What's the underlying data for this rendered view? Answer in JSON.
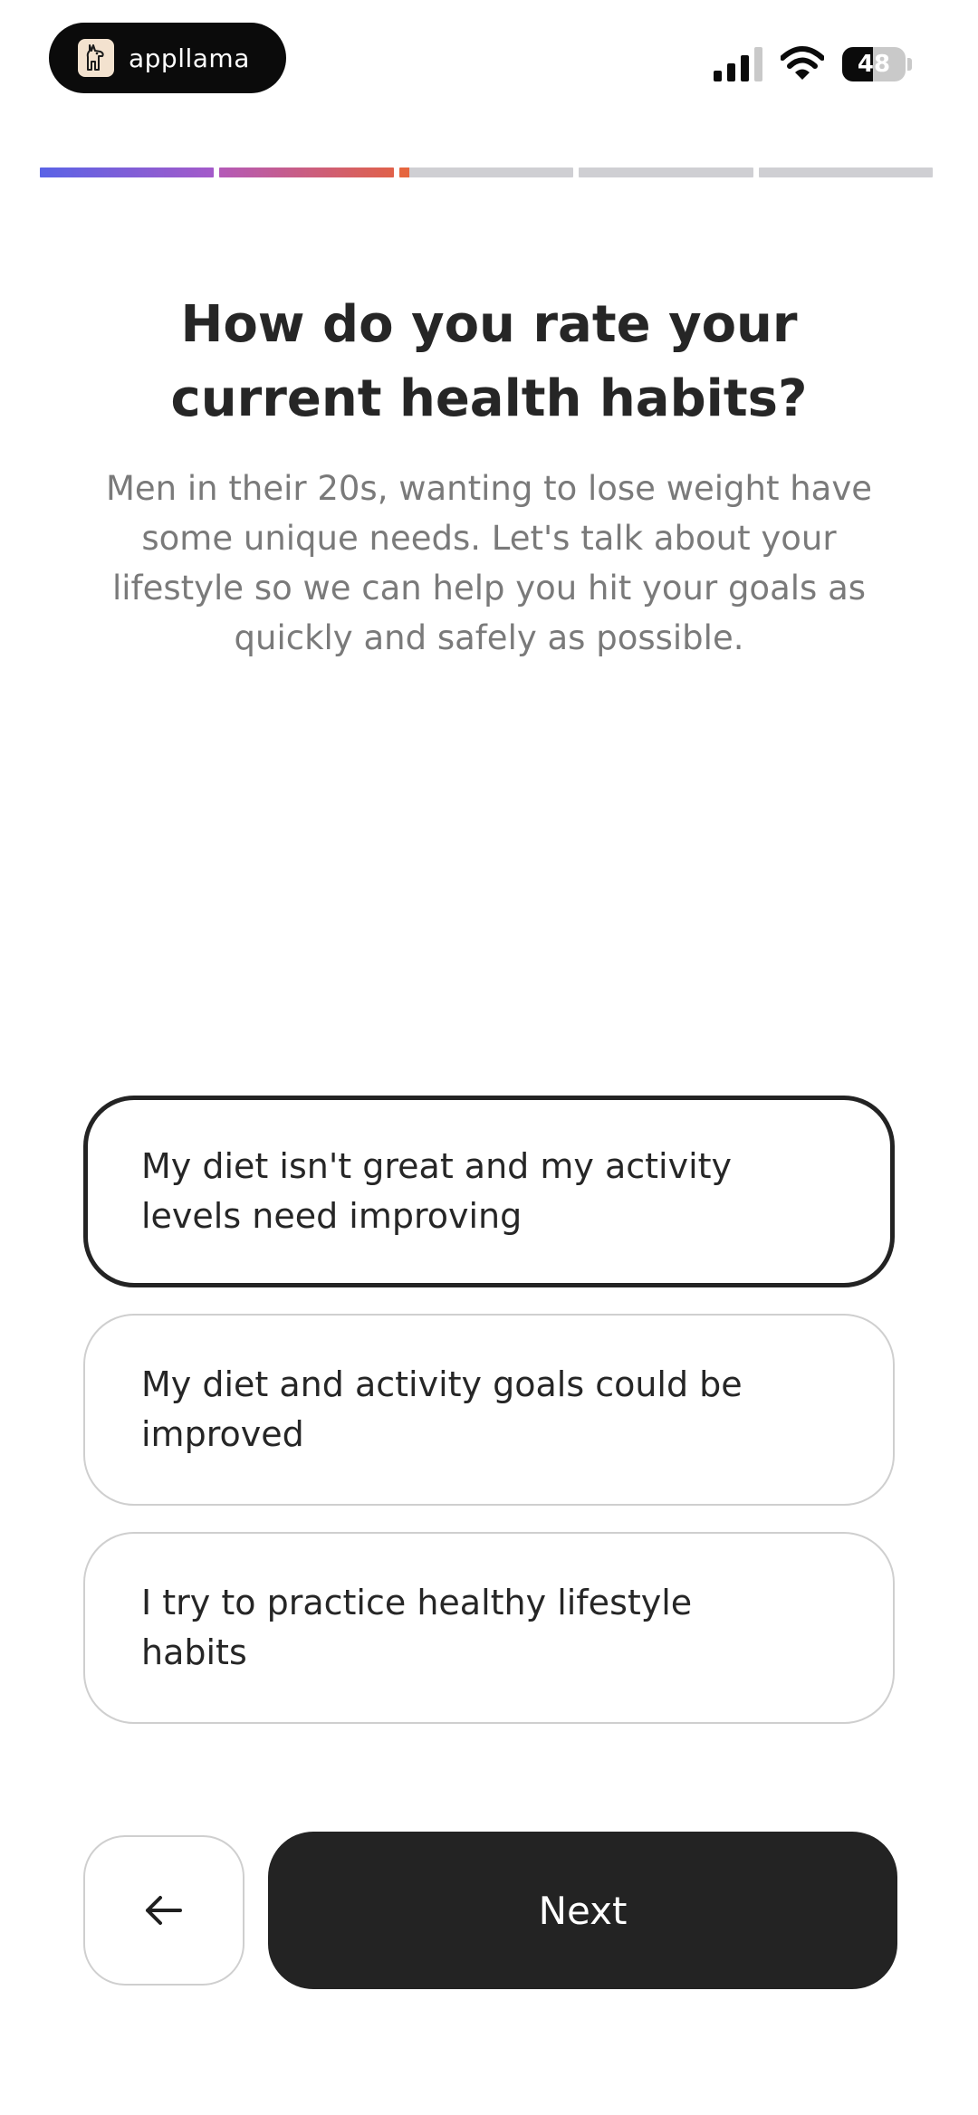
{
  "status_bar": {
    "app_name": "appllama",
    "app_icon": "llama-icon",
    "battery_level": "48",
    "battery_fraction": 0.48,
    "signal_icon": "cellular-signal-icon",
    "wifi_icon": "wifi-icon"
  },
  "progress": {
    "total_steps": 5,
    "segments_fill": [
      1,
      1,
      0.06,
      0,
      0
    ],
    "segment_colors": [
      "linear-gradient(90deg,#5a63e6,#a45ac9)",
      "linear-gradient(90deg,#b45ab8,#e0614a)",
      "#e5663f",
      "#cfcfd3",
      "#cfcfd3"
    ]
  },
  "question": {
    "title": "How do you rate your current health habits?",
    "subtitle": "Men in their 20s, wanting to lose weight have some unique needs. Let's talk about your lifestyle so we can help you hit your goals as quickly and safely as possible."
  },
  "options": [
    {
      "label": "My diet isn't great and my activity levels need improving",
      "selected": true
    },
    {
      "label": "My diet and activity goals could be improved",
      "selected": false
    },
    {
      "label": "I try to practice healthy lifestyle habits",
      "selected": false
    }
  ],
  "footer": {
    "back_icon": "arrow-left-icon",
    "next_label": "Next"
  },
  "colors": {
    "primary_dark": "#232323",
    "muted_text": "#7a7a7a",
    "border_light": "#cfcfcf"
  }
}
